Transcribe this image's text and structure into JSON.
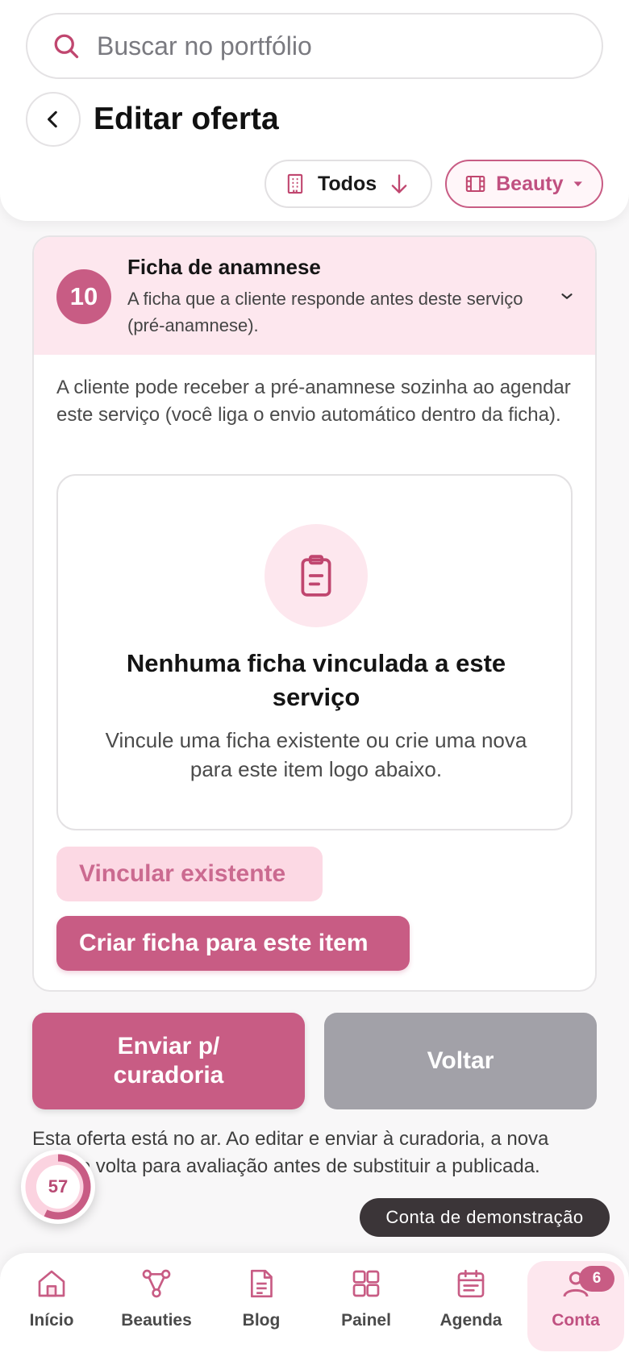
{
  "search": {
    "placeholder": "Buscar no portfólio"
  },
  "header": {
    "title": "Editar oferta"
  },
  "filters": {
    "todos_label": "Todos",
    "beauty_label": "Beauty"
  },
  "section": {
    "step": "10",
    "title": "Ficha de anamnese",
    "subtitle": "A ficha que a cliente responde antes deste serviço (pré-anamnese).",
    "description": "A cliente pode receber a pré-anamnese sozinha ao agendar este serviço (você liga o envio automático dentro da ficha).",
    "empty_title": "Nenhuma ficha vinculada a este serviço",
    "empty_subtitle": "Vincule uma ficha existente ou crie uma nova para este item logo abaixo.",
    "link_existing_label": "Vincular existente",
    "create_label": "Criar ficha para este item"
  },
  "actions": {
    "send_label": "Enviar p/ curadoria",
    "back_label": "Voltar"
  },
  "notice": "Esta oferta está no ar. Ao editar e enviar à curadoria, a nova versão volta para avaliação antes de substituir a publicada.",
  "progress": {
    "value": "57",
    "fraction": 0.57
  },
  "demo_label": "Conta de demonstração",
  "nav": {
    "items": [
      {
        "label": "Início",
        "icon": "home-icon"
      },
      {
        "label": "Beauties",
        "icon": "network-icon"
      },
      {
        "label": "Blog",
        "icon": "document-icon"
      },
      {
        "label": "Painel",
        "icon": "grid-icon"
      },
      {
        "label": "Agenda",
        "icon": "calendar-icon"
      },
      {
        "label": "Conta",
        "icon": "user-icon",
        "badge": "6"
      }
    ]
  },
  "colors": {
    "accent": "#c85c84",
    "accent_soft": "#fde7ee",
    "muted_button": "#a2a1a8",
    "dark_pill": "#3b3538"
  }
}
